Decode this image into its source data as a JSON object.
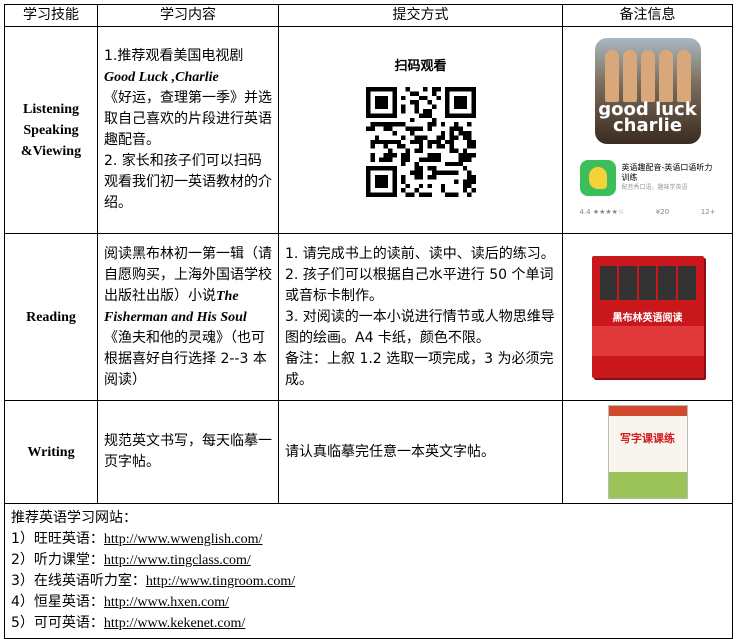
{
  "headers": [
    "学习技能",
    "学习内容",
    "提交方式",
    "备注信息"
  ],
  "rows": [
    {
      "skill": [
        "Listening",
        "Speaking",
        "&Viewing"
      ],
      "content": {
        "line1": "1.推荐观看美国电视剧",
        "show_en": "Good Luck ,Charlie",
        "line2": "《好运，查理第一季》并选取自己喜欢的片段进行英语趣配音。",
        "line3": "2. 家长和孩子们可以扫码观看我们初一英语教材的介绍。"
      },
      "submit": {
        "label": "扫码观看"
      },
      "notes": {
        "show_logo": "good luck charlie",
        "app_name": "英语趣配音-英语口语听力训练",
        "app_sub": "配音秀口语，趣味学英语",
        "rating": "4.4 ★★★★☆",
        "age": "¥20",
        "plus": "12+"
      }
    },
    {
      "skill": [
        "Reading"
      ],
      "content": {
        "line1": "阅读黑布林初一第一辑（请自愿购买，上海外国语学校出版社出版）小说",
        "book_en": "The Fisherman and His Soul",
        "line2": "《渔夫和他的灵魂》（也可根据喜好自行选择 2--3 本阅读）"
      },
      "submit": {
        "text": "1. 请完成书上的读前、读中、读后的练习。\n2. 孩子们可以根据自己水平进行 50 个单词或音标卡制作。\n3. 对阅读的一本小说进行情节或人物思维导图的绘画。A4 卡纸，颜色不限。\n备注：上叙 1.2 选取一项完成，3 为必须完成。"
      },
      "notes": {
        "book_title": "黑布林英语阅读"
      }
    },
    {
      "skill": [
        "Writing"
      ],
      "content": {
        "line1": "规范英文书写，每天临摹一页字帖。"
      },
      "submit": {
        "text": "请认真临摹完任意一本英文字帖。"
      },
      "notes": {
        "book_title": "写字课课练"
      }
    }
  ],
  "websites": {
    "title": "推荐英语学习网站：",
    "items": [
      {
        "label": "1）旺旺英语：",
        "url": "http://www.wwenglish.com/"
      },
      {
        "label": "2）听力课堂：",
        "url": "http://www.tingclass.com/"
      },
      {
        "label": "3）在线英语听力室：",
        "url": "http://www.tingroom.com/"
      },
      {
        "label": "4）恒星英语：",
        "url": "http://www.hxen.com/"
      },
      {
        "label": "5）可可英语：",
        "url": "http://www.kekenet.com/"
      }
    ]
  }
}
